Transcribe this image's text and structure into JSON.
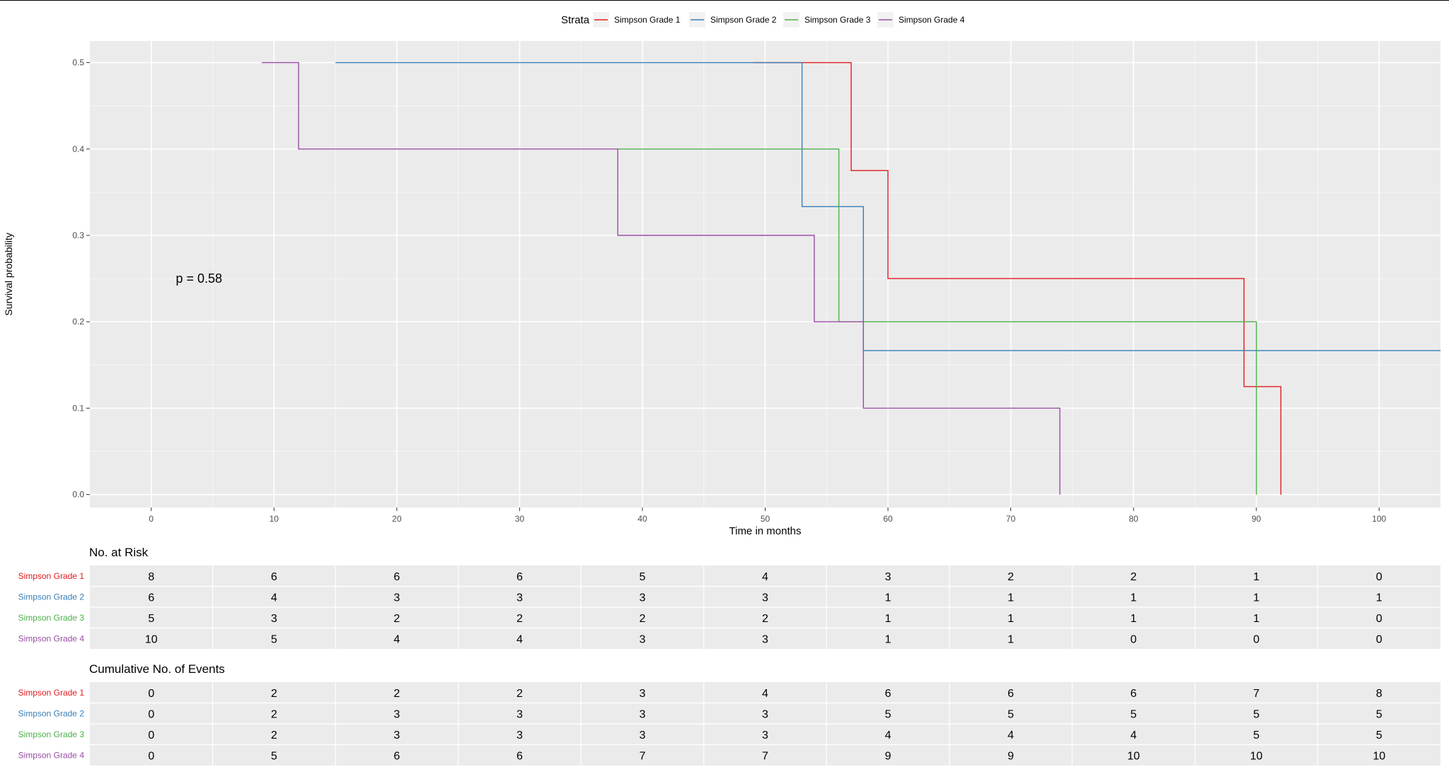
{
  "chart_data": {
    "type": "step",
    "xlabel": "Time in months",
    "ylabel": "Survival probability",
    "xlim": [
      -5,
      105
    ],
    "ylim": [
      -0.015,
      0.525
    ],
    "xticks": [
      0,
      10,
      20,
      30,
      40,
      50,
      60,
      70,
      80,
      90,
      100
    ],
    "yticks": [
      0.0,
      0.1,
      0.2,
      0.3,
      0.4,
      0.5
    ],
    "grid": true,
    "legend": {
      "title": "Strata",
      "position": "top"
    },
    "annotation": {
      "text": "p = 0.58",
      "x": 2,
      "y": 0.25
    },
    "series": [
      {
        "name": "Simpson Grade 1",
        "color": "#e41a1c",
        "points": [
          [
            49,
            0.5
          ],
          [
            57,
            0.5
          ],
          [
            57,
            0.375
          ],
          [
            60,
            0.375
          ],
          [
            60,
            0.25
          ],
          [
            89,
            0.25
          ],
          [
            89,
            0.125
          ],
          [
            92,
            0.125
          ],
          [
            92,
            0.0
          ]
        ]
      },
      {
        "name": "Simpson Grade 2",
        "color": "#377eb8",
        "points": [
          [
            15,
            0.5
          ],
          [
            53,
            0.5
          ],
          [
            53,
            0.3333
          ],
          [
            58,
            0.3333
          ],
          [
            58,
            0.1667
          ],
          [
            105,
            0.1667
          ]
        ]
      },
      {
        "name": "Simpson Grade 3",
        "color": "#4daf4a",
        "points": [
          [
            38,
            0.4
          ],
          [
            56,
            0.4
          ],
          [
            56,
            0.2
          ],
          [
            90,
            0.2
          ],
          [
            90,
            0.0
          ]
        ]
      },
      {
        "name": "Simpson Grade 4",
        "color": "#984ea3",
        "points": [
          [
            9,
            0.5
          ],
          [
            12,
            0.5
          ],
          [
            12,
            0.4
          ],
          [
            38,
            0.4
          ],
          [
            38,
            0.3
          ],
          [
            54,
            0.3
          ],
          [
            54,
            0.2
          ],
          [
            58,
            0.2
          ],
          [
            58,
            0.1
          ],
          [
            74,
            0.1
          ],
          [
            74,
            0.0
          ]
        ]
      }
    ],
    "tables": [
      {
        "title": "No. at Risk",
        "rows": [
          {
            "name": "Simpson Grade 1",
            "color": "#e41a1c",
            "values": [
              8,
              6,
              6,
              6,
              5,
              4,
              3,
              2,
              2,
              1,
              0
            ]
          },
          {
            "name": "Simpson Grade 2",
            "color": "#377eb8",
            "values": [
              6,
              4,
              3,
              3,
              3,
              3,
              1,
              1,
              1,
              1,
              1
            ]
          },
          {
            "name": "Simpson Grade 3",
            "color": "#4daf4a",
            "values": [
              5,
              3,
              2,
              2,
              2,
              2,
              1,
              1,
              1,
              1,
              0
            ]
          },
          {
            "name": "Simpson Grade 4",
            "color": "#984ea3",
            "values": [
              10,
              5,
              4,
              4,
              3,
              3,
              1,
              1,
              0,
              0,
              0
            ]
          }
        ]
      },
      {
        "title": "Cumulative No. of Events",
        "rows": [
          {
            "name": "Simpson Grade 1",
            "color": "#e41a1c",
            "values": [
              0,
              2,
              2,
              2,
              3,
              4,
              6,
              6,
              6,
              7,
              8
            ]
          },
          {
            "name": "Simpson Grade 2",
            "color": "#377eb8",
            "values": [
              0,
              2,
              3,
              3,
              3,
              3,
              5,
              5,
              5,
              5,
              5
            ]
          },
          {
            "name": "Simpson Grade 3",
            "color": "#4daf4a",
            "values": [
              0,
              2,
              3,
              3,
              3,
              3,
              4,
              4,
              4,
              5,
              5
            ]
          },
          {
            "name": "Simpson Grade 4",
            "color": "#984ea3",
            "values": [
              0,
              5,
              6,
              6,
              7,
              7,
              9,
              9,
              10,
              10,
              10
            ]
          }
        ]
      }
    ]
  }
}
